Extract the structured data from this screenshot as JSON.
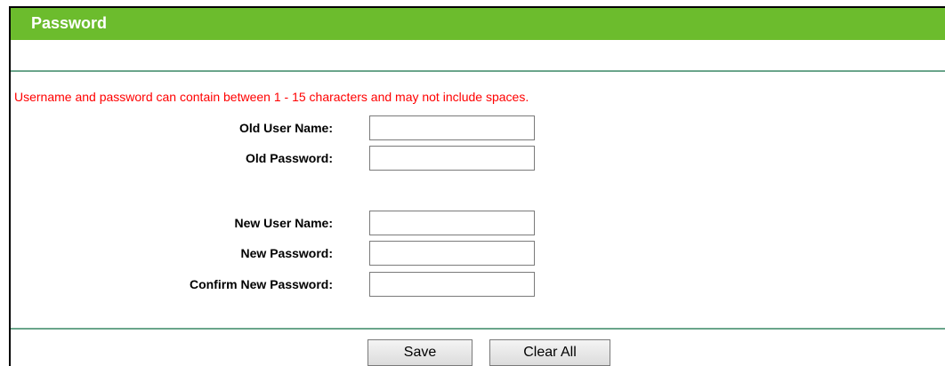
{
  "header": {
    "title": "Password"
  },
  "notice": "Username and password can contain between 1 - 15 characters and may not include spaces.",
  "fields": {
    "old_user_name": {
      "label": "Old User Name:",
      "value": ""
    },
    "old_password": {
      "label": "Old Password:",
      "value": ""
    },
    "new_user_name": {
      "label": "New User Name:",
      "value": ""
    },
    "new_password": {
      "label": "New Password:",
      "value": ""
    },
    "confirm_new_password": {
      "label": "Confirm New Password:",
      "value": ""
    }
  },
  "buttons": {
    "save": "Save",
    "clear_all": "Clear All"
  },
  "colors": {
    "header_bg": "#6cbc2d",
    "notice_text": "#ff0000",
    "divider": "#6aa58b"
  }
}
